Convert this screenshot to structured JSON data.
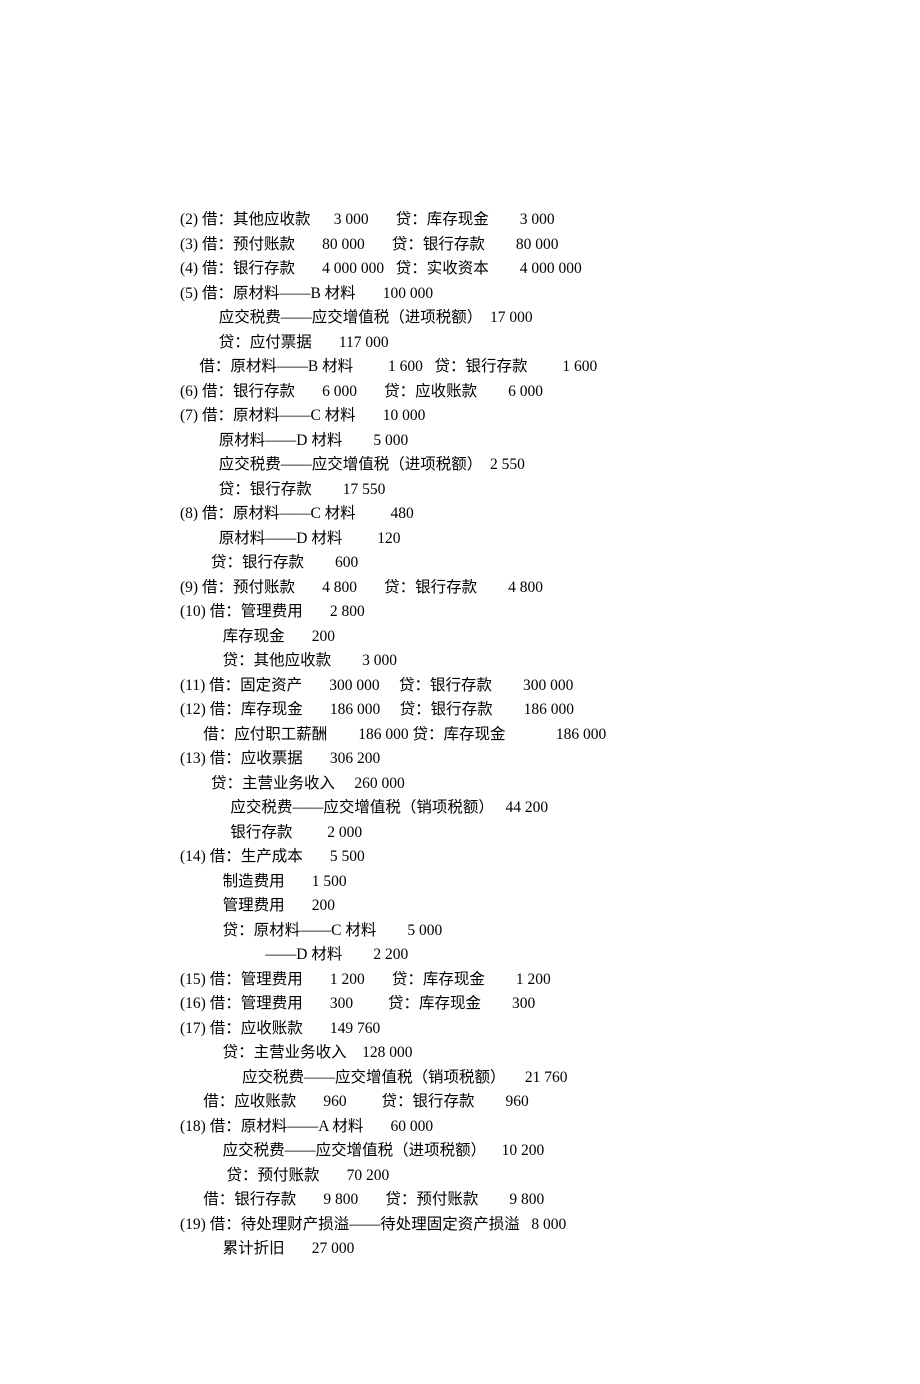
{
  "lines": [
    "(2) 借：其他应收款      3 000       贷：库存现金        3 000",
    "(3) 借：预付账款       80 000       贷：银行存款        80 000",
    "(4) 借：银行存款       4 000 000   贷：实收资本        4 000 000",
    "(5) 借：原材料——B 材料       100 000",
    "          应交税费——应交增值税（进项税额）  17 000",
    "          贷：应付票据       117 000",
    "     借：原材料——B 材料         1 600   贷：银行存款         1 600",
    "(6) 借：银行存款       6 000       贷：应收账款        6 000",
    "(7) 借：原材料——C 材料       10 000",
    "          原材料——D 材料        5 000",
    "          应交税费——应交增值税（进项税额）  2 550",
    "          贷：银行存款        17 550",
    "(8) 借：原材料——C 材料         480",
    "          原材料——D 材料         120",
    "        贷：银行存款        600",
    "(9) 借：预付账款       4 800       贷：银行存款        4 800",
    "(10) 借：管理费用       2 800",
    "           库存现金       200",
    "           贷：其他应收款        3 000",
    "(11) 借：固定资产       300 000     贷：银行存款        300 000",
    "(12) 借：库存现金       186 000     贷：银行存款        186 000",
    "      借：应付职工薪酬        186 000 贷：库存现金             186 000",
    "(13) 借：应收票据       306 200",
    "        贷：主营业务收入     260 000",
    "             应交税费——应交增值税（销项税额）   44 200",
    "             银行存款         2 000",
    "(14) 借：生产成本       5 500",
    "           制造费用       1 500",
    "           管理费用       200",
    "           贷：原材料——C 材料        5 000",
    "                      ——D 材料        2 200",
    "(15) 借：管理费用       1 200       贷：库存现金        1 200",
    "(16) 借：管理费用       300         贷：库存现金        300",
    "(17) 借：应收账款       149 760",
    "           贷：主营业务收入    128 000",
    "                应交税费——应交增值税（销项税额）     21 760",
    "      借：应收账款       960         贷：银行存款        960",
    "(18) 借：原材料——A 材料       60 000",
    "           应交税费——应交增值税（进项税额）    10 200",
    "            贷：预付账款       70 200",
    "      借：银行存款       9 800       贷：预付账款        9 800",
    "",
    "(19) 借：待处理财产损溢——待处理固定资产损溢   8 000",
    "           累计折旧       27 000"
  ]
}
